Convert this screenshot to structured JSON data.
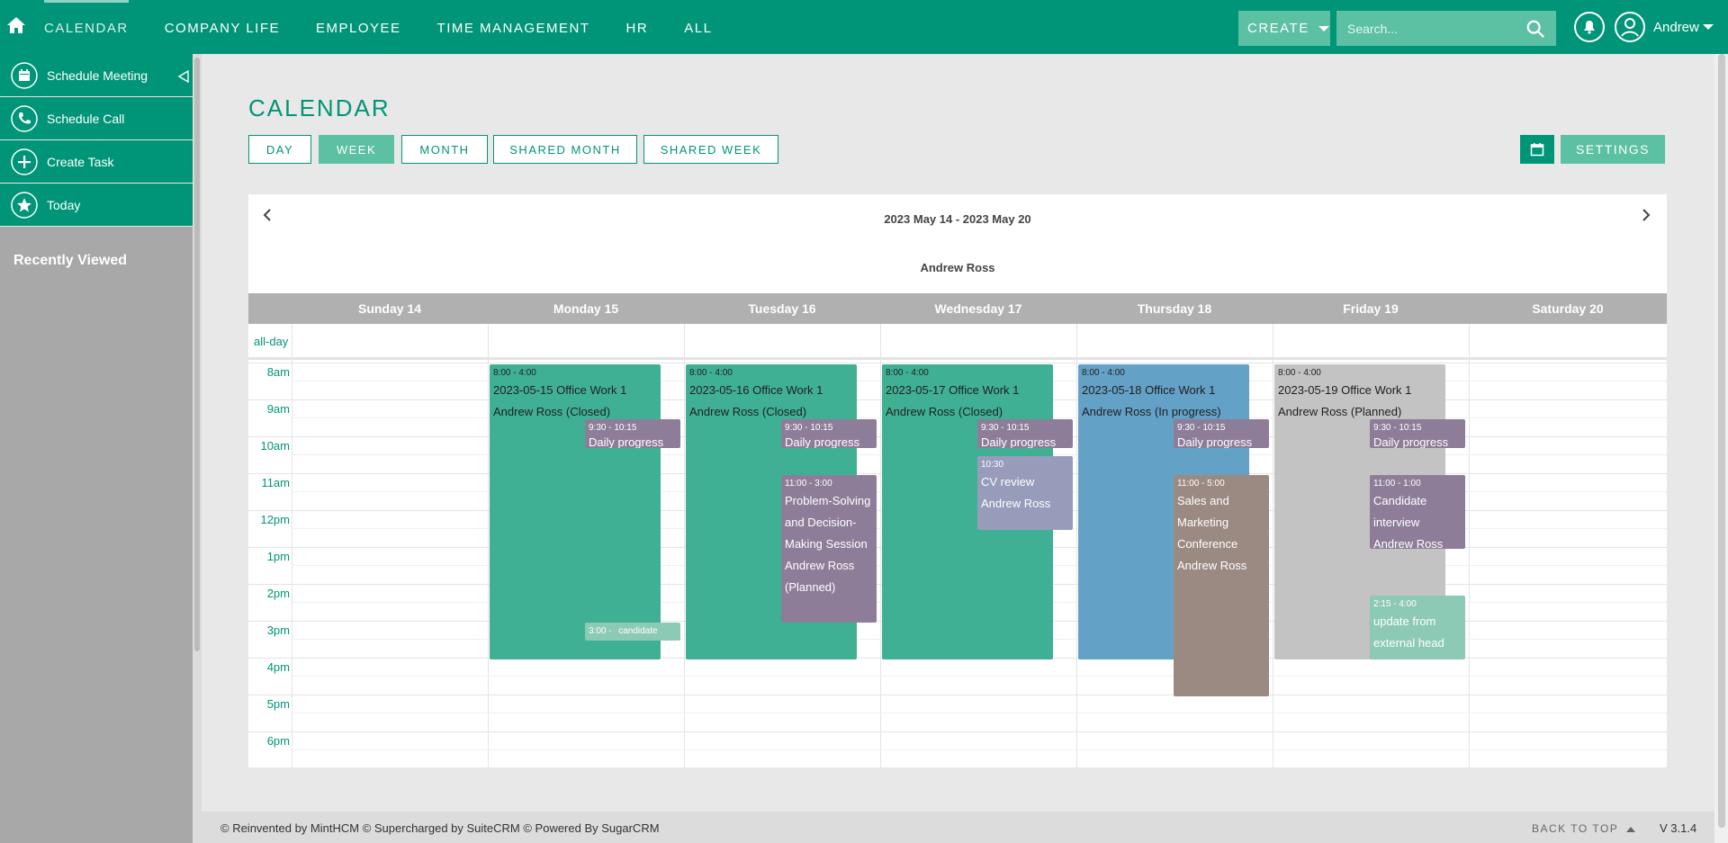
{
  "nav": {
    "items": [
      "CALENDAR",
      "COMPANY LIFE",
      "EMPLOYEE",
      "TIME MANAGEMENT",
      "HR",
      "ALL"
    ],
    "create_label": "CREATE",
    "search_placeholder": "Search...",
    "user_name": "Andrew"
  },
  "sidebar": {
    "items": [
      {
        "label": "Schedule Meeting",
        "icon": "calendar-icon"
      },
      {
        "label": "Schedule Call",
        "icon": "phone-icon"
      },
      {
        "label": "Create Task",
        "icon": "plus-icon"
      },
      {
        "label": "Today",
        "icon": "star-icon"
      }
    ],
    "recently_viewed": "Recently Viewed"
  },
  "page": {
    "title": "CALENDAR",
    "views": [
      "DAY",
      "WEEK",
      "MONTH",
      "SHARED MONTH",
      "SHARED WEEK"
    ],
    "active_view": "WEEK",
    "settings_label": "SETTINGS"
  },
  "calendar": {
    "range": "2023 May 14 - 2023 May 20",
    "user": "Andrew Ross",
    "allday_label": "all-day",
    "days": [
      "Sunday 14",
      "Monday 15",
      "Tuesday 16",
      "Wednesday 17",
      "Thursday 18",
      "Friday 19",
      "Saturday 20"
    ],
    "hours": [
      "8am",
      "9am",
      "10am",
      "11am",
      "12pm",
      "1pm",
      "2pm",
      "3pm",
      "4pm",
      "5pm",
      "6pm"
    ],
    "events": [
      {
        "day": 1,
        "time": "8:00 - 4:00",
        "title": "2023-05-15 Office Work 1",
        "sub": "Andrew Ross (Closed)"
      },
      {
        "day": 2,
        "time": "8:00 - 4:00",
        "title": "2023-05-16 Office Work 1",
        "sub": "Andrew Ross (Closed)"
      },
      {
        "day": 3,
        "time": "8:00 - 4:00",
        "title": "2023-05-17 Office Work 1",
        "sub": "Andrew Ross (Closed)"
      },
      {
        "day": 4,
        "time": "8:00 - 4:00",
        "title": "2023-05-18 Office Work 1",
        "sub": "Andrew Ross (In progress)"
      },
      {
        "day": 5,
        "time": "8:00 - 4:00",
        "title": "2023-05-19 Office Work 1",
        "sub": "Andrew Ross (Planned)"
      },
      {
        "day": 1,
        "time": "9:30 - 10:15",
        "title": "Daily progress"
      },
      {
        "day": 2,
        "time": "9:30 - 10:15",
        "title": "Daily progress"
      },
      {
        "day": 3,
        "time": "9:30 - 10:15",
        "title": "Daily progress"
      },
      {
        "day": 4,
        "time": "9:30 - 10:15",
        "title": "Daily progress"
      },
      {
        "day": 5,
        "time": "9:30 - 10:15",
        "title": "Daily progress"
      },
      {
        "day": 2,
        "time": "11:00 - 3:00",
        "title": "Problem-Solving and Decision-Making Session Andrew Ross (Planned)"
      },
      {
        "day": 3,
        "time": "10:30",
        "title": "CV review Andrew Ross"
      },
      {
        "day": 4,
        "time": "11:00 - 5:00",
        "title": "Sales and Marketing Conference Andrew Ross"
      },
      {
        "day": 5,
        "time": "11:00 - 1:00",
        "title": "Candidate interview Andrew Ross"
      },
      {
        "day": 5,
        "time": "2:15 - 4:00",
        "title": "update from external head"
      },
      {
        "day": 1,
        "time": "3:00 -",
        "title": "candidate phone"
      }
    ]
  },
  "footer": {
    "credits": "© Reinvented by MintHCM   © Supercharged by SuiteCRM  © Powered By SugarCRM",
    "back_to_top": "BACK TO TOP",
    "version": "V 3.1.4"
  }
}
